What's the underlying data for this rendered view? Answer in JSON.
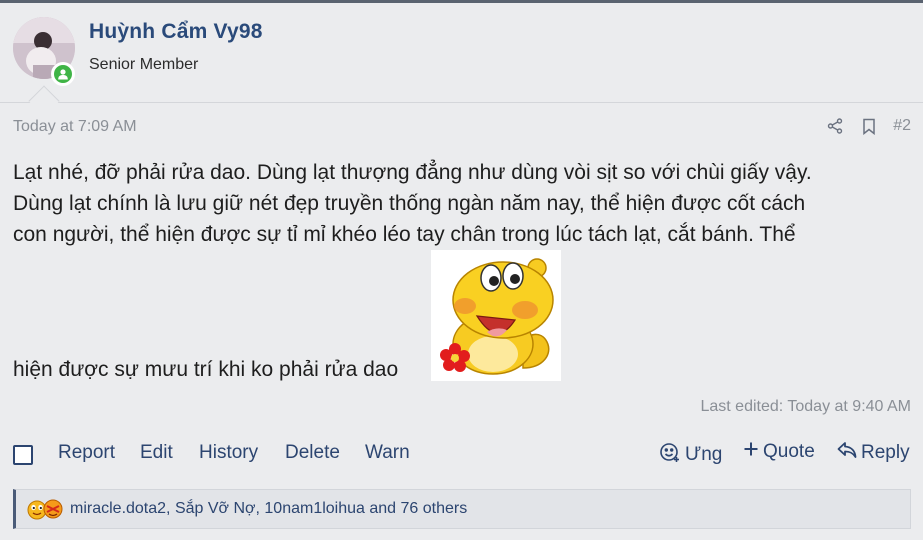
{
  "user": {
    "name": "Huỳnh Cẩm Vy98",
    "title": "Senior Member",
    "online": true
  },
  "post": {
    "date": "Today at 7:09 AM",
    "number": "#2",
    "body_lines": [
      "Lạt nhé, đỡ phải rửa dao. Dùng lạt thượng đẳng như dùng vòi sịt so với chùi giấy vậy.",
      "Dùng lạt chính là lưu giữ nét đẹp truyền thống ngàn năm nay, thể hiện được cốt cách",
      "con người, thể hiện được sự tỉ mỉ khéo léo tay chân trong lúc tách lạt, cắt bánh. Thể"
    ],
    "body_last": "hiện được sự mưu trí khi ko phải rửa dao",
    "last_edited": "Last edited: Today at 9:40 AM"
  },
  "actions": {
    "report": "Report",
    "edit": "Edit",
    "history": "History",
    "delete": "Delete",
    "warn": "Warn",
    "react": "Ưng",
    "quote": "Quote",
    "reply": "Reply"
  },
  "reactions": {
    "text": "miracle.dota2, Sắp Vỡ Nợ, 10nam1loihua and 76 others"
  },
  "icons": {
    "share": "share-icon",
    "bookmark": "bookmark-icon",
    "react": "smiley-icon",
    "quote": "plus-icon",
    "reply": "reply-arrow-icon"
  },
  "colors": {
    "link": "#2c4570",
    "username": "#2a4a7a",
    "muted": "#8a8f96",
    "online": "#3fb446",
    "background": "#ebecee"
  }
}
